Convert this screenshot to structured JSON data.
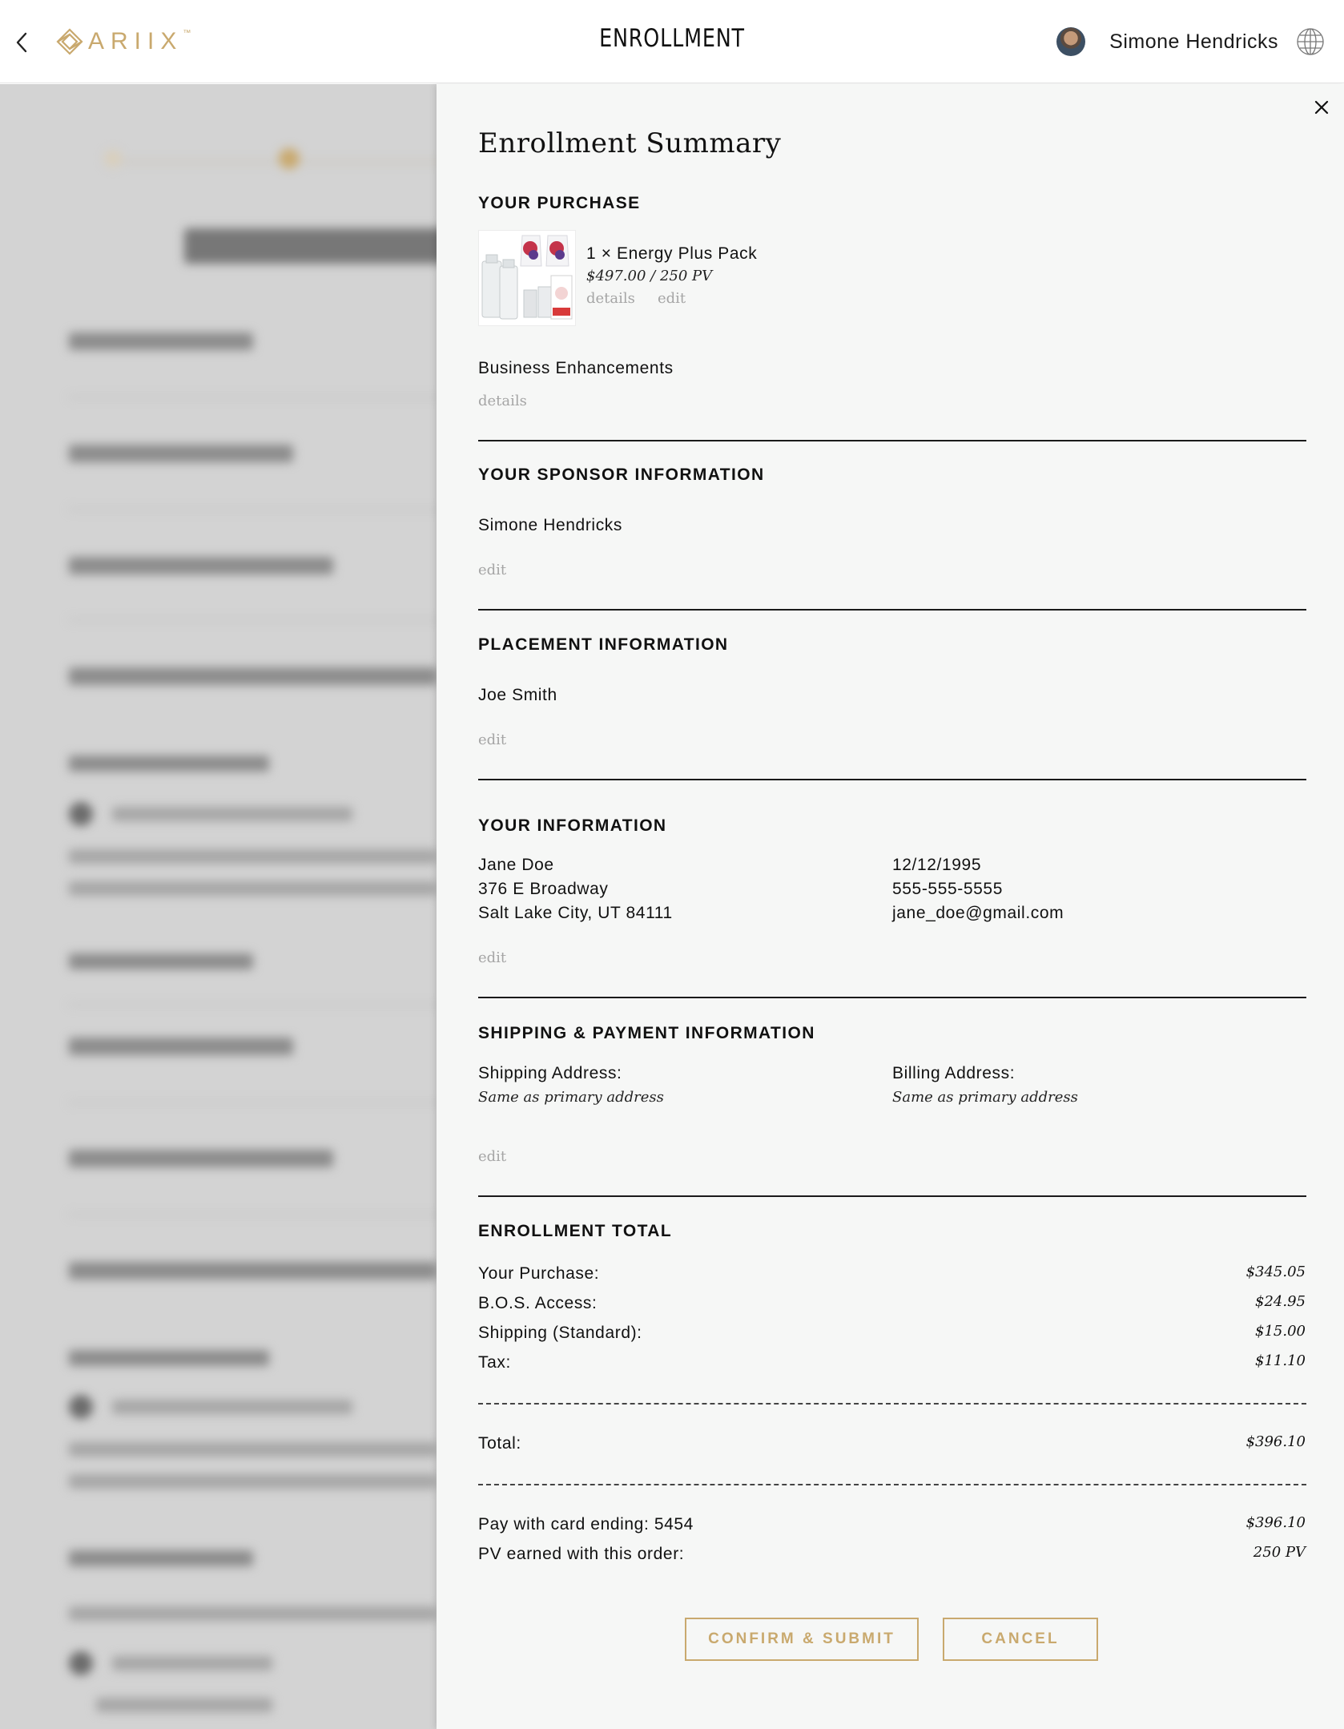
{
  "header": {
    "back_icon": "chevron-left-icon",
    "logo_text": "ARIIX",
    "logo_tm": "™",
    "title": "ENROLLMENT",
    "user_name": "Simone Hendricks",
    "globe_icon": "globe-icon",
    "brand_color": "#c9a96e"
  },
  "summary": {
    "close_icon": "close-icon",
    "title": "Enrollment Summary",
    "purchase": {
      "heading": "YOUR PURCHASE",
      "item_name": "1 × Energy Plus Pack",
      "item_price": "$497.00 / 250 PV",
      "details_link": "details",
      "edit_link": "edit",
      "enhancements_label": "Business Enhancements",
      "enhancements_details_link": "details"
    },
    "sponsor": {
      "heading": "YOUR SPONSOR INFORMATION",
      "name": "Simone Hendricks",
      "edit_link": "edit"
    },
    "placement": {
      "heading": "PLACEMENT INFORMATION",
      "name": "Joe Smith",
      "edit_link": "edit"
    },
    "your_info": {
      "heading": "YOUR INFORMATION",
      "name": "Jane Doe",
      "street": "376 E Broadway",
      "city": "Salt Lake City, UT 84111",
      "dob": "12/12/1995",
      "phone": "555-555-5555",
      "email": "jane_doe@gmail.com",
      "edit_link": "edit"
    },
    "shipping_payment": {
      "heading": "SHIPPING & PAYMENT INFORMATION",
      "shipping_label": "Shipping Address:",
      "shipping_value": "Same as primary address",
      "billing_label": "Billing Address:",
      "billing_value": "Same as primary address",
      "edit_link": "edit"
    },
    "total": {
      "heading": "ENROLLMENT TOTAL",
      "lines": [
        {
          "label": "Your Purchase:",
          "value": "$345.05"
        },
        {
          "label": "B.O.S. Access:",
          "value": "$24.95"
        },
        {
          "label": "Shipping (Standard):",
          "value": "$15.00"
        },
        {
          "label": "Tax:",
          "value": "$11.10"
        }
      ],
      "total_label": "Total:",
      "total_value": "$396.10",
      "card_label": "Pay with card ending: 5454",
      "card_value": "$396.10",
      "pv_label": "PV earned with this order:",
      "pv_value": "250 PV"
    },
    "confirm_button": "CONFIRM & SUBMIT",
    "cancel_button": "CANCEL"
  }
}
